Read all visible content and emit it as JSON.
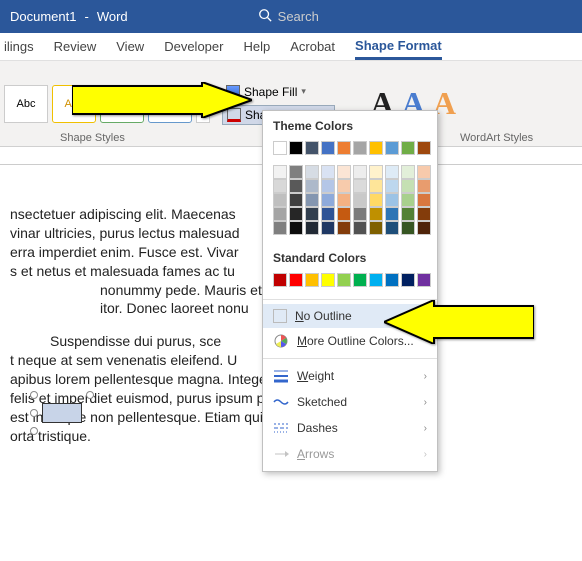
{
  "titlebar": {
    "doc_name": "Document1",
    "app_name": "Word",
    "search_placeholder": "Search"
  },
  "tabs": {
    "mailings": "ilings",
    "review": "Review",
    "view": "View",
    "developer": "Developer",
    "help": "Help",
    "acrobat": "Acrobat",
    "shape_format": "Shape Format"
  },
  "ribbon": {
    "abc": "Abc",
    "shape_fill": "Shape Fill",
    "shape_outline": "Shape Outline",
    "group_shape_styles": "Shape Styles",
    "group_wordart": "WordArt Styles",
    "wa_letter": "A"
  },
  "dropdown": {
    "theme_colors": "Theme Colors",
    "standard_colors": "Standard Colors",
    "no_outline": "No Outline",
    "more_colors": "More Outline Colors...",
    "weight": "Weight",
    "sketched": "Sketched",
    "dashes": "Dashes",
    "arrows": "Arrows",
    "theme_row1": [
      "#ffffff",
      "#000000",
      "#44546a",
      "#4472c4",
      "#ed7d31",
      "#a5a5a5",
      "#ffc000",
      "#5b9bd5",
      "#70ad47",
      "#9e480e"
    ],
    "theme_shades": [
      [
        "#f2f2f2",
        "#7f7f7f",
        "#d6dce4",
        "#d9e2f3",
        "#fbe5d5",
        "#ededed",
        "#fff2cc",
        "#deebf6",
        "#e2efd9",
        "#f7caac"
      ],
      [
        "#d8d8d8",
        "#595959",
        "#adb9ca",
        "#b4c6e7",
        "#f7cbac",
        "#dbdbdb",
        "#fee599",
        "#bdd7ee",
        "#c5e0b3",
        "#e89c6e"
      ],
      [
        "#bfbfbf",
        "#3f3f3f",
        "#8496b0",
        "#8eaadb",
        "#f4b183",
        "#c9c9c9",
        "#ffd965",
        "#9cc3e5",
        "#a8d08d",
        "#d9773f"
      ],
      [
        "#a5a5a5",
        "#262626",
        "#323f4f",
        "#2f5496",
        "#c55a11",
        "#7b7b7b",
        "#bf9000",
        "#2e75b5",
        "#538135",
        "#833c0b"
      ],
      [
        "#7f7f7f",
        "#0c0c0c",
        "#222a35",
        "#1f3864",
        "#833c0b",
        "#525252",
        "#7f6000",
        "#1e4e79",
        "#375623",
        "#4f240a"
      ]
    ],
    "std_colors": [
      "#c00000",
      "#ff0000",
      "#ffc000",
      "#ffff00",
      "#92d050",
      "#00b050",
      "#00b0f0",
      "#0070c0",
      "#002060",
      "#7030a0"
    ]
  },
  "doc_text": {
    "p1a": "nsectetuer adipiscing elit. Maecenas",
    "p1b": "vinar ultricies, purus lectus malesuad",
    "p1c": "erra imperdiet enim. Fusce est. Vivar",
    "p1d": "s et netus et malesuada fames ac tu",
    "p1e": "nonummy pede. Mauris et o",
    "p1f": "itor. Donec laoreet nonu",
    "p2a": "Suspendisse dui purus, sce",
    "p2b": "t neque at sem venenatis eleifend. U",
    "p2c": "apibus lorem pellentesque magna. Integer nulla. Donec blandit",
    "p2d": "felis et imperdiet euismod, purus ipsum pretium metus, in lacinia",
    "p2e": "est in neque non pellentesque. Etiam quis urna. Aliquam odoo",
    "p2f": "orta tristique."
  }
}
